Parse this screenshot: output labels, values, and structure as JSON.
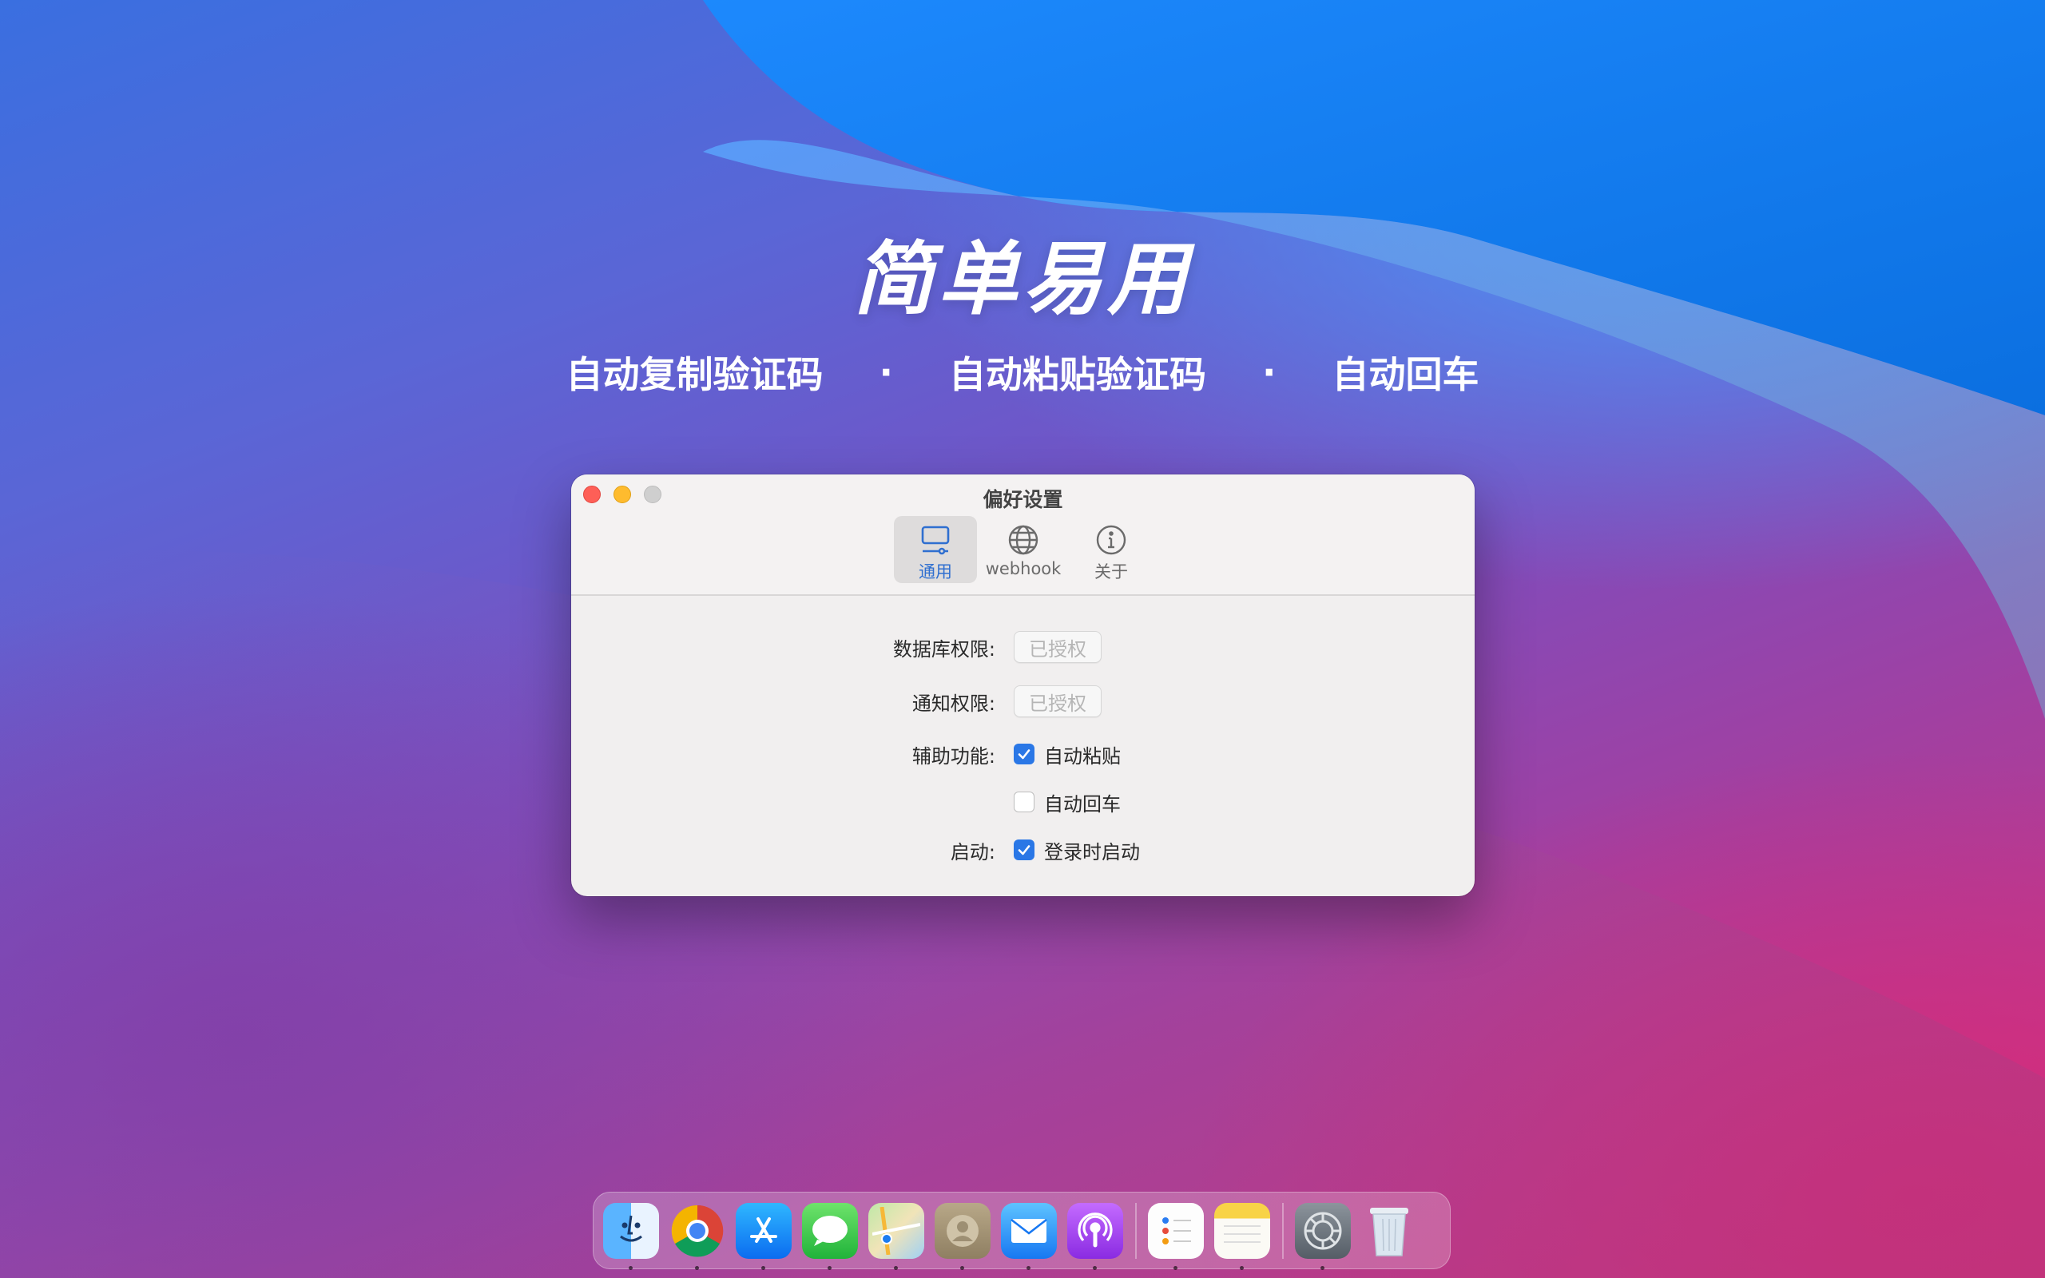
{
  "hero": {
    "title": "简单易用",
    "features": [
      "自动复制验证码",
      "自动粘贴验证码",
      "自动回车"
    ],
    "separator": "·"
  },
  "window": {
    "title": "偏好设置",
    "tabs": [
      {
        "label": "通用",
        "icon": "monitor-icon",
        "active": true
      },
      {
        "label": "webhook",
        "icon": "globe-icon",
        "active": false
      },
      {
        "label": "关于",
        "icon": "info-icon",
        "active": false
      }
    ],
    "general": {
      "db_permission_label": "数据库权限:",
      "db_permission_button": "已授权",
      "notify_permission_label": "通知权限:",
      "notify_permission_button": "已授权",
      "accessibility_label": "辅助功能:",
      "auto_paste_label": "自动粘贴",
      "auto_paste_checked": true,
      "auto_enter_label": "自动回车",
      "auto_enter_checked": false,
      "startup_label": "启动:",
      "launch_at_login_label": "登录时启动",
      "launch_at_login_checked": true
    }
  },
  "colors": {
    "accent": "#2a77e6",
    "close": "#fe5f57",
    "minimize": "#febb2e",
    "zoom": "#cfcfcf"
  },
  "dock": {
    "apps": [
      "finder-icon",
      "chrome-icon",
      "app-store-icon",
      "messages-icon",
      "maps-icon",
      "contacts-icon",
      "mail-icon",
      "podcasts-icon",
      "reminders-icon",
      "notes-icon",
      "system-preferences-icon",
      "trash-icon"
    ]
  }
}
